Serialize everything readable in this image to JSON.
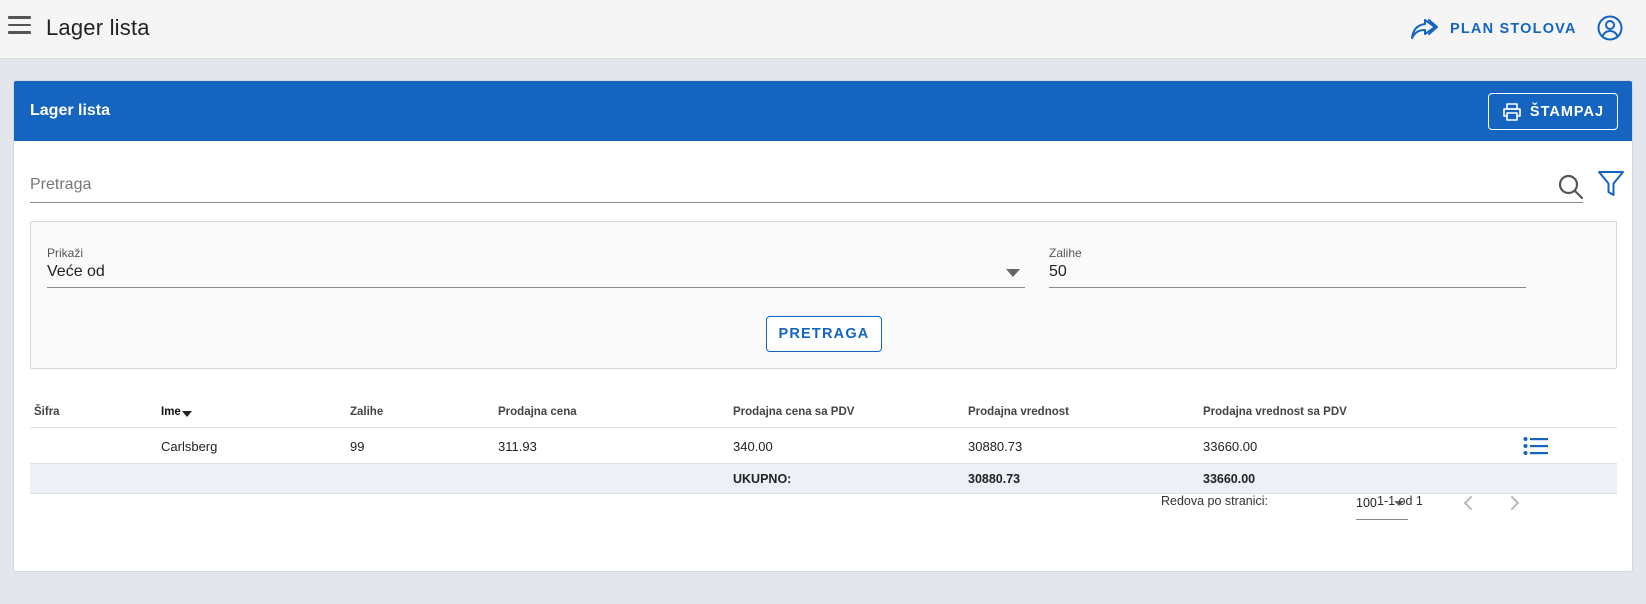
{
  "header": {
    "title": "Lager lista",
    "plan_label": "PLAN STOLOVA",
    "icons": {
      "menu": "menu-icon",
      "plan": "share-arrows-icon",
      "account": "account-circle-icon"
    }
  },
  "card": {
    "title": "Lager lista",
    "print_label": "ŠTAMPAJ"
  },
  "search": {
    "placeholder": "Pretraga",
    "value": ""
  },
  "filters": {
    "show_label": "Prikaži",
    "show_value": "Veće od",
    "stock_label": "Zalihe",
    "stock_value": "50",
    "search_button": "PRETRAGA"
  },
  "table": {
    "columns": [
      "Šifra",
      "Ime",
      "Zalihe",
      "Prodajna cena",
      "Prodajna cena sa PDV",
      "Prodajna vrednost",
      "Prodajna vrednost sa PDV"
    ],
    "sorted_column": "Ime",
    "rows": [
      {
        "sifra": "",
        "ime": "Carlsberg",
        "zalihe": "99",
        "cena": "311.93",
        "cena_pdv": "340.00",
        "vrednost": "30880.73",
        "vrednost_pdv": "33660.00"
      }
    ],
    "total": {
      "label": "UKUPNO:",
      "vrednost": "30880.73",
      "vrednost_pdv": "33660.00"
    }
  },
  "pagination": {
    "rows_per_page_label": "Redova po stranici:",
    "rows_per_page_value": "100",
    "range": "1-1 od 1"
  },
  "colors": {
    "primary": "#1565c0",
    "background": "#e4e6ee",
    "topbar": "#f5f5f5",
    "total_row": "#eef0f8"
  }
}
